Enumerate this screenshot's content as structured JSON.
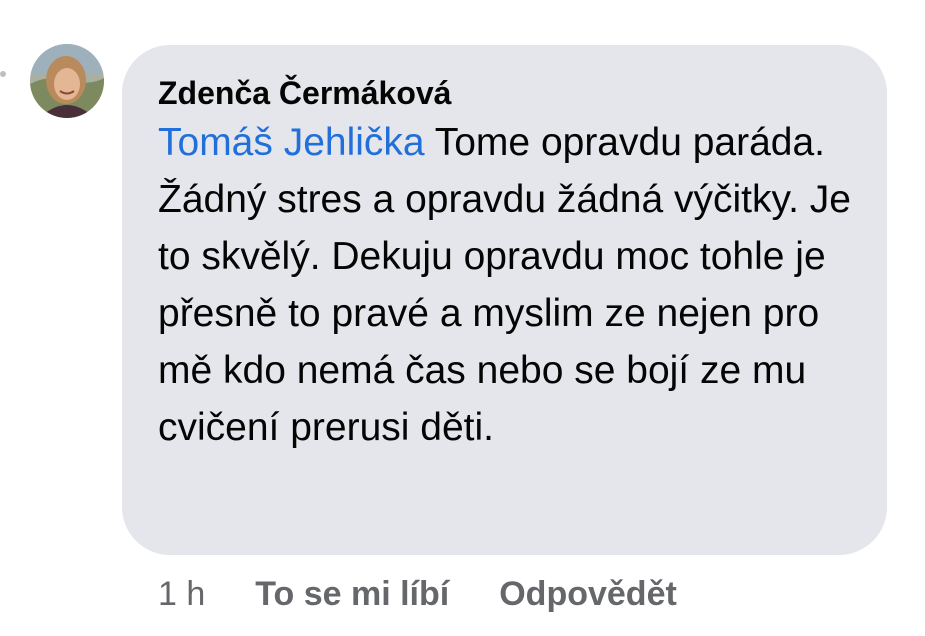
{
  "comment": {
    "author": "Zdenča Čermáková",
    "mention": "Tomáš Jehlička",
    "body": " Tome opravdu paráda. Žádný stres a opravdu žádná výčitky. Je to skvělý. Dekuju opravdu moc tohle je přesně to pravé a myslim ze nejen pro mě kdo nemá čas nebo se bojí ze mu cvičení prerusi děti."
  },
  "actions": {
    "time": "1 h",
    "like_label": "To se mi líbí",
    "reply_label": "Odpovědět"
  },
  "colors": {
    "bubble": "#e4e6eb",
    "mention": "#216fdb",
    "meta": "#65676b"
  }
}
